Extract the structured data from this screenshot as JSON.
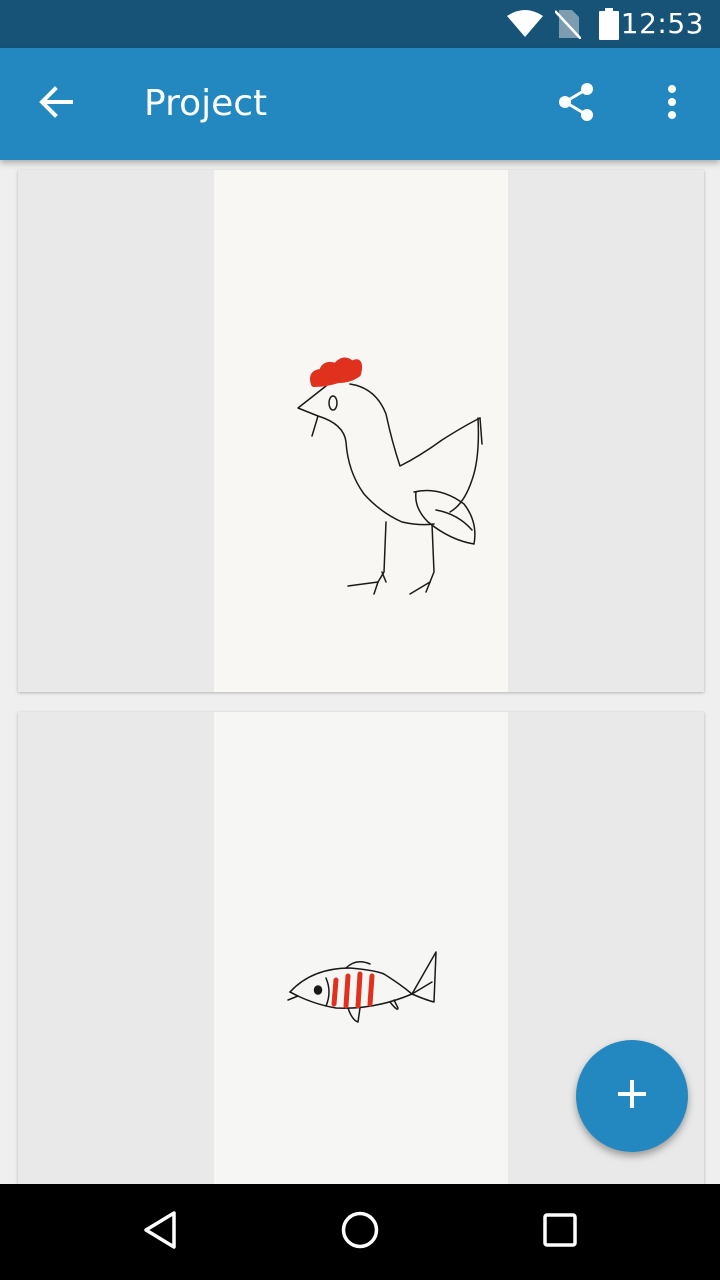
{
  "status_bar": {
    "time": "12:53",
    "icons": [
      "wifi-icon",
      "no-sim-icon",
      "battery-icon"
    ]
  },
  "app_bar": {
    "title": "Project",
    "back_icon": "arrow-back-icon",
    "share_icon": "share-icon",
    "overflow_icon": "more-vert-icon"
  },
  "pages": [
    {
      "drawing": "chicken",
      "background": "#f8f7f3",
      "stroke_colors": [
        "#1a1a1a",
        "#e0301e"
      ]
    },
    {
      "drawing": "fish",
      "background": "#f6f6f5",
      "stroke_colors": [
        "#1a1a1a",
        "#e0301e"
      ]
    }
  ],
  "fab": {
    "icon": "plus-icon",
    "color": "#2288bf"
  },
  "navigation_bar": {
    "buttons": [
      "back-triangle-icon",
      "home-circle-icon",
      "recents-square-icon"
    ]
  },
  "colors": {
    "primary": "#2288bf",
    "primary_dark": "#175377",
    "card_margin": "#e9e9e9"
  }
}
